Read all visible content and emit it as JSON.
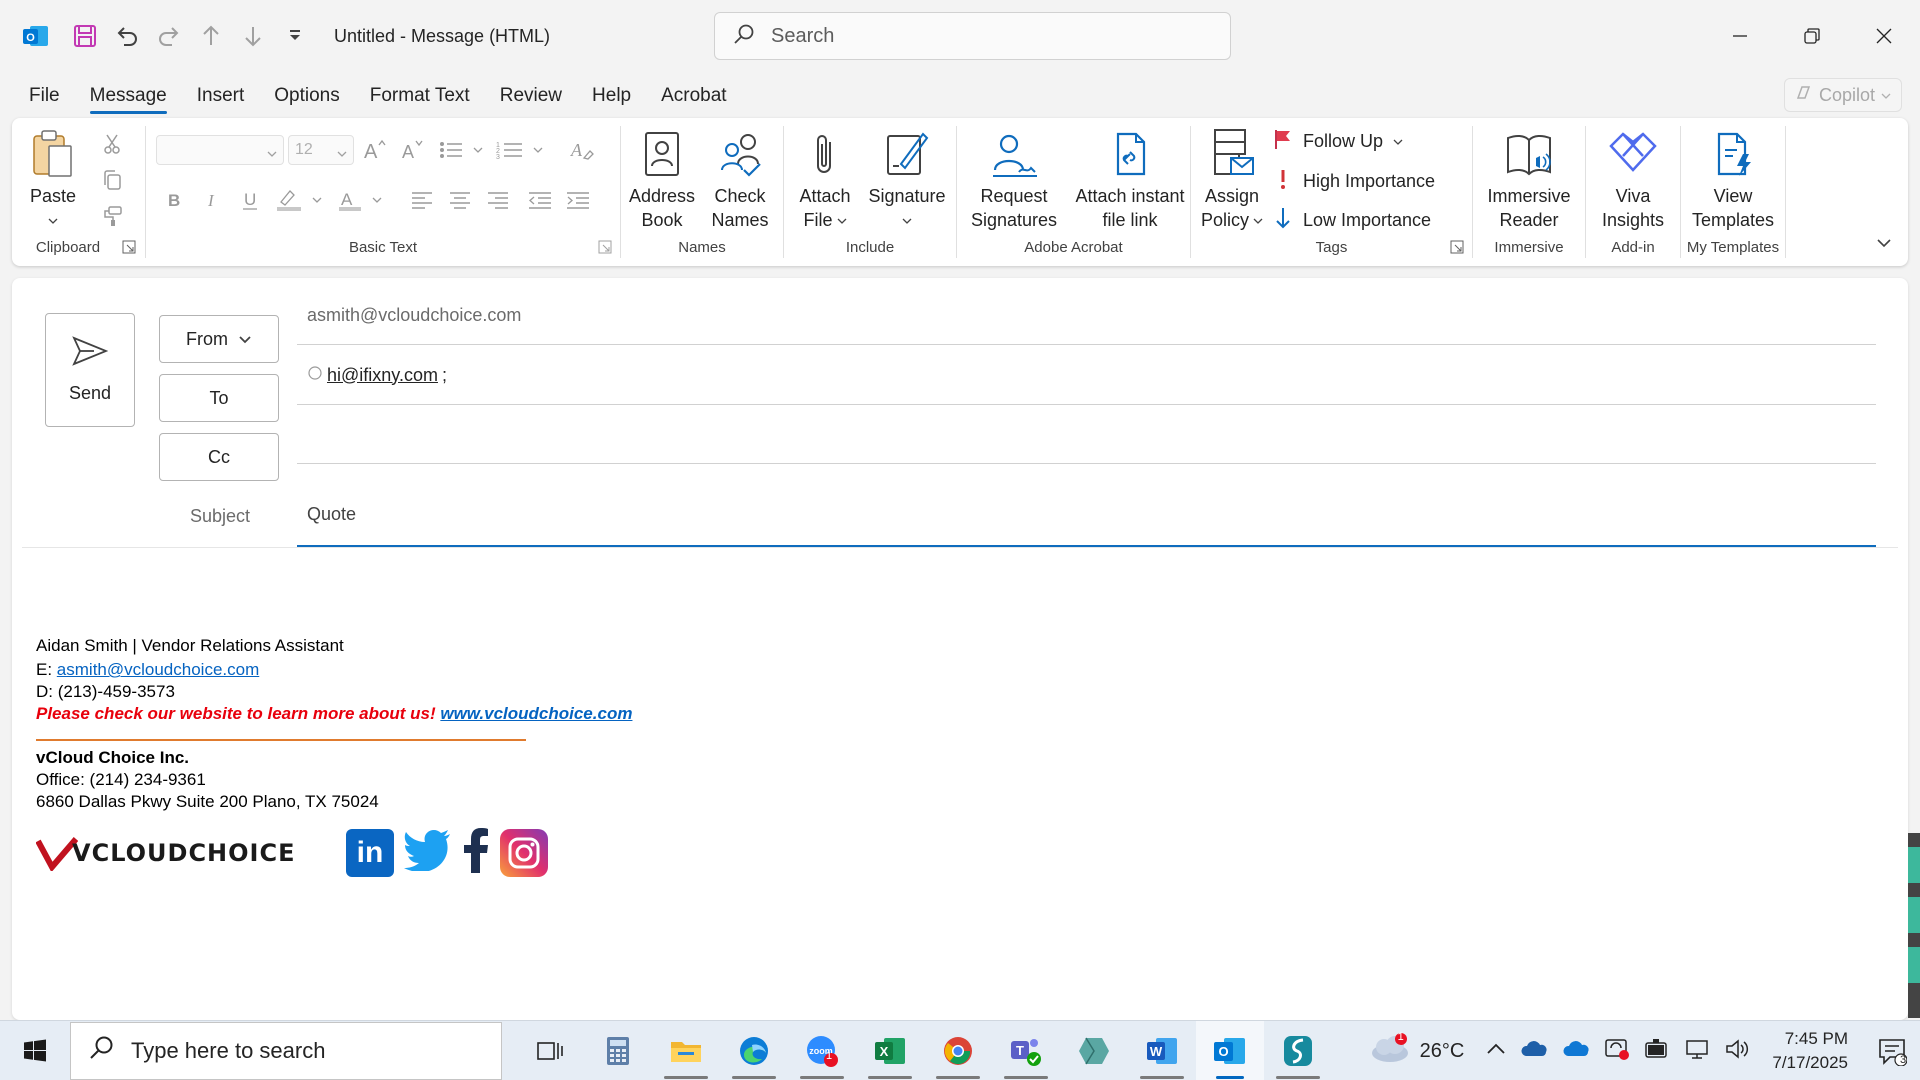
{
  "window": {
    "title": "Untitled  -  Message (HTML)",
    "search_placeholder": "Search"
  },
  "tabs": [
    "File",
    "Message",
    "Insert",
    "Options",
    "Format Text",
    "Review",
    "Help",
    "Acrobat"
  ],
  "active_tab": "Message",
  "copilot_label": "Copilot",
  "ribbon": {
    "clipboard": {
      "label": "Clipboard",
      "paste": "Paste"
    },
    "basic_text": {
      "label": "Basic Text",
      "font_size": "12"
    },
    "names": {
      "label": "Names",
      "address_book": [
        "Address",
        "Book"
      ],
      "check_names": [
        "Check",
        "Names"
      ]
    },
    "include": {
      "label": "Include",
      "attach_file": [
        "Attach",
        "File"
      ],
      "signature": "Signature"
    },
    "adobe_acrobat": {
      "label": "Adobe Acrobat",
      "request_signatures": [
        "Request",
        "Signatures"
      ],
      "attach_link": [
        "Attach instant",
        "file link"
      ]
    },
    "tags": {
      "label": "Tags",
      "assign_policy": [
        "Assign",
        "Policy"
      ],
      "follow_up": "Follow Up",
      "high_importance": "High Importance",
      "low_importance": "Low Importance"
    },
    "immersive": {
      "label": "Immersive",
      "reader": [
        "Immersive",
        "Reader"
      ]
    },
    "addin": {
      "label": "Add-in",
      "viva": [
        "Viva",
        "Insights"
      ]
    },
    "templates": {
      "label": "My Templates",
      "view": [
        "View",
        "Templates"
      ]
    }
  },
  "compose": {
    "send": "Send",
    "from_label": "From",
    "from_value": "asmith@vcloudchoice.com",
    "to_label": "To",
    "to_value": "hi@ifixny.com",
    "to_sep": ";",
    "cc_label": "Cc",
    "cc_value": "",
    "subject_label": "Subject",
    "subject_value": "Quote"
  },
  "signature": {
    "name_line": "Aidan Smith | Vendor Relations Assistant",
    "email_prefix": "E: ",
    "email": "asmith@vcloudchoice.com",
    "phone": "D: (213)-459-3573",
    "promo": "Please check our website to learn more about us! ",
    "website": "www.vcloudchoice.com",
    "company": "vCloud Choice Inc.",
    "office": "Office: (214) 234-9361",
    "address": "6860 Dallas Pkwy Suite 200 Plano, TX 75024",
    "logo_text": "VCLOUDCHOICE",
    "social_in": "in"
  },
  "taskbar": {
    "search_placeholder": "Type here to search",
    "weather_temp": "26°C",
    "weather_badge": "1",
    "zoom_badge": "1",
    "time": "7:45 PM",
    "date": "7/17/2025",
    "notification_count": "3"
  },
  "colors": {
    "accent": "#0f6cbd",
    "link": "#0563c1",
    "promo_red": "#e8000c",
    "rule_orange": "#e07b2e"
  }
}
